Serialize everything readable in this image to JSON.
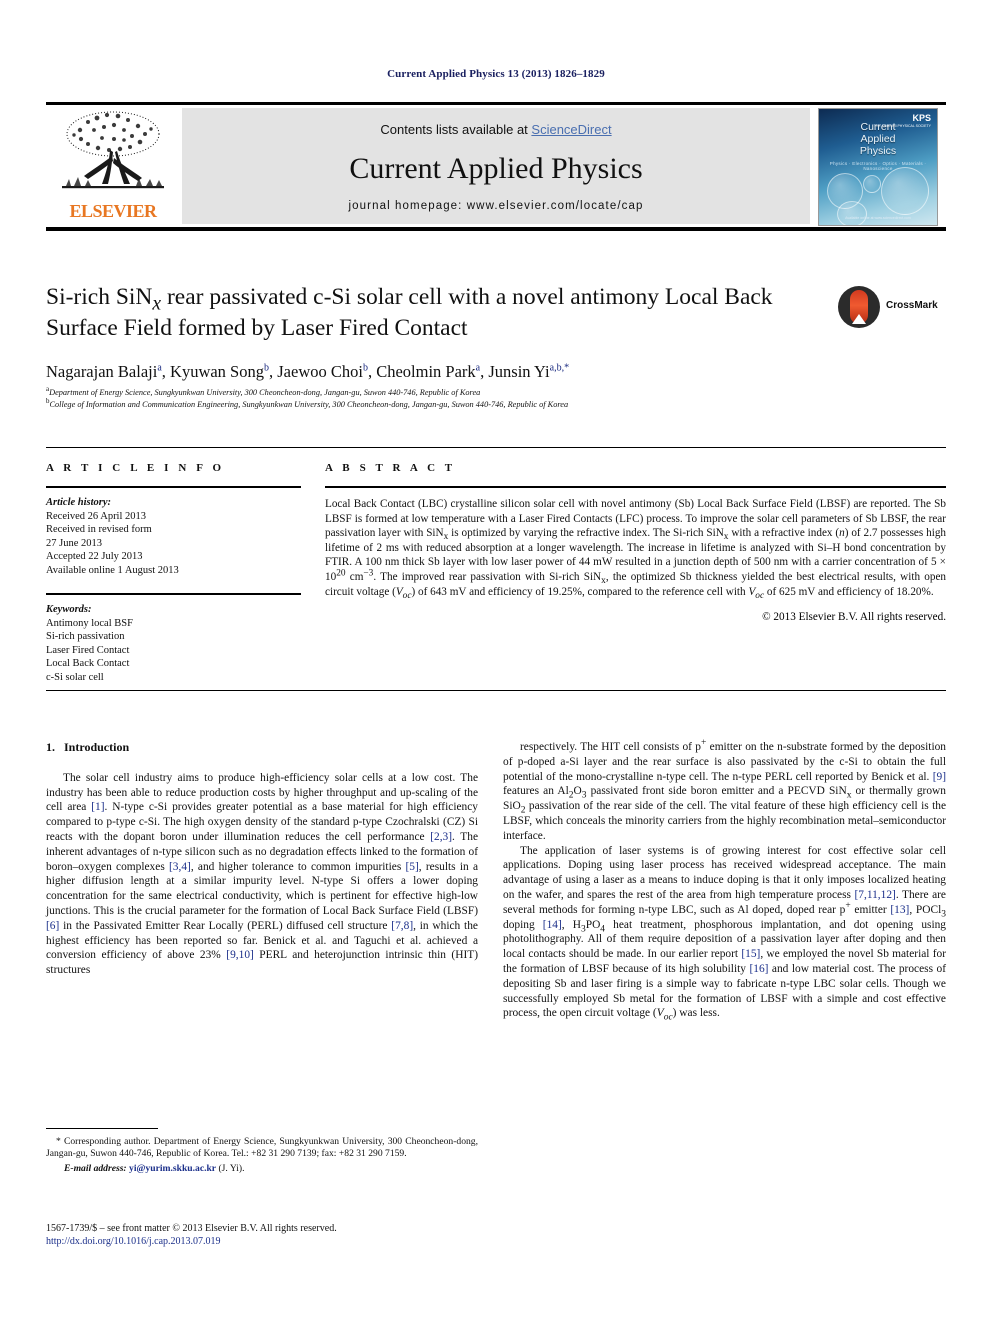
{
  "running_head": "Current Applied Physics 13 (2013) 1826–1829",
  "masthead": {
    "contents_prefix": "Contents lists available at ",
    "sciencedirect": "ScienceDirect",
    "journal_name": "Current Applied Physics",
    "homepage": "journal homepage: www.elsevier.com/locate/cap",
    "publisher_wordmark": "ELSEVIER",
    "cover": {
      "line1": "Current",
      "line2": "Applied",
      "line3": "Physics",
      "subtitle": "Physics · Electronics · Optics · Materials · Nanoscience",
      "society": "KPS",
      "society_sub": "THE KOREAN PHYSICAL SOCIETY",
      "footer": "Available online at www.sciencedirect.com"
    }
  },
  "article": {
    "title_line1_a": "Si-rich SiN",
    "title_line1_sub": "x",
    "title_line1_b": " rear passivated c-Si solar cell with a novel antimony",
    "title_line2": "Local Back Surface Field formed by Laser Fired Contact",
    "authors": [
      {
        "name": "Nagarajan Balaji",
        "marks": "a"
      },
      {
        "name": "Kyuwan Song",
        "marks": "b"
      },
      {
        "name": "Jaewoo Choi",
        "marks": "b"
      },
      {
        "name": "Cheolmin Park",
        "marks": "a"
      },
      {
        "name": "Junsin Yi",
        "marks": "a,b,*"
      }
    ],
    "affiliations": [
      {
        "mark": "a",
        "text": "Department of Energy Science, Sungkyunkwan University, 300 Cheoncheon-dong, Jangan-gu, Suwon 440-746, Republic of Korea"
      },
      {
        "mark": "b",
        "text": "College of Information and Communication Engineering, Sungkyunkwan University, 300 Cheoncheon-dong, Jangan-gu, Suwon 440-746, Republic of Korea"
      }
    ],
    "crossmark_label": "CrossMark"
  },
  "article_info": {
    "heading": "A R T I C L E   I N F O",
    "history_label": "Article history:",
    "history": [
      "Received 26 April 2013",
      "Received in revised form",
      "27 June 2013",
      "Accepted 22 July 2013",
      "Available online 1 August 2013"
    ],
    "keywords_label": "Keywords:",
    "keywords": [
      "Antimony local BSF",
      "Si-rich passivation",
      "Laser Fired Contact",
      "Local Back Contact",
      "c-Si solar cell"
    ]
  },
  "abstract": {
    "heading": "A B S T R A C T",
    "copyright": "© 2013 Elsevier B.V. All rights reserved.",
    "parts": [
      {
        "t": "text",
        "v": "Local Back Contact (LBC) crystalline silicon solar cell with novel antimony (Sb) Local Back Surface Field (LBSF) are reported. The Sb LBSF is formed at low temperature with a Laser Fired Contacts (LFC) process. To improve the solar cell parameters of Sb LBSF, the rear passivation layer with SiN"
      },
      {
        "t": "sub",
        "v": "x"
      },
      {
        "t": "text",
        "v": " is optimized by varying the refractive index. The Si-rich SiN"
      },
      {
        "t": "sub",
        "v": "x"
      },
      {
        "t": "text",
        "v": " with a refractive index ("
      },
      {
        "t": "ital",
        "v": "n"
      },
      {
        "t": "text",
        "v": ") of 2.7 possesses high lifetime of 2 ms with reduced absorption at a longer wavelength. The increase in lifetime is analyzed with Si–H bond concentration by FTIR. A 100 nm thick Sb layer with low laser power of 44 mW resulted in a junction depth of 500 nm with a carrier concentration of 5 × 10"
      },
      {
        "t": "sup",
        "v": "20"
      },
      {
        "t": "text",
        "v": " cm"
      },
      {
        "t": "sup",
        "v": "−3"
      },
      {
        "t": "text",
        "v": ". The improved rear passivation with Si-rich SiN"
      },
      {
        "t": "sub",
        "v": "x"
      },
      {
        "t": "text",
        "v": ", the optimized Sb thickness yielded the best electrical results, with open circuit voltage ("
      },
      {
        "t": "ital",
        "v": "V"
      },
      {
        "t": "italsub",
        "v": "oc"
      },
      {
        "t": "text",
        "v": ") of 643 mV and efficiency of 19.25%, compared to the reference cell with "
      },
      {
        "t": "ital",
        "v": "V"
      },
      {
        "t": "italsub",
        "v": "oc"
      },
      {
        "t": "text",
        "v": " of 625 mV and efficiency of 18.20%."
      }
    ]
  },
  "body": {
    "section_number": "1.",
    "section_title": "Introduction",
    "left_paragraphs": [
      [
        {
          "t": "text",
          "v": "The solar cell industry aims to produce high-efficiency solar cells at a low cost. The industry has been able to reduce production costs by higher throughput and up-scaling of the cell area "
        },
        {
          "t": "ref",
          "v": "[1]"
        },
        {
          "t": "text",
          "v": ". N-type c-Si provides greater potential as a base material for high efficiency compared to p-type c-Si. The high oxygen density of the standard p-type Czochralski (CZ) Si reacts with the dopant boron under illumination reduces the cell performance "
        },
        {
          "t": "ref",
          "v": "[2,3]"
        },
        {
          "t": "text",
          "v": ". The inherent advantages of n-type silicon such as no degradation effects linked to the formation of boron–oxygen complexes "
        },
        {
          "t": "ref",
          "v": "[3,4]"
        },
        {
          "t": "text",
          "v": ", and higher tolerance to common impurities "
        },
        {
          "t": "ref",
          "v": "[5]"
        },
        {
          "t": "text",
          "v": ", results in a higher diffusion length at a similar impurity level. N-type Si offers a lower doping concentration for the same electrical conductivity, which is pertinent for effective high-low junctions. This is the crucial parameter for the formation of Local Back Surface Field (LBSF) "
        },
        {
          "t": "ref",
          "v": "[6]"
        },
        {
          "t": "text",
          "v": " in the Passivated Emitter Rear Locally (PERL) diffused cell structure "
        },
        {
          "t": "ref",
          "v": "[7,8]"
        },
        {
          "t": "text",
          "v": ", in which the highest efficiency has been reported so far. Benick et al. and Taguchi et al. achieved a conversion efficiency of above 23% "
        },
        {
          "t": "ref",
          "v": "[9,10]"
        },
        {
          "t": "text",
          "v": " PERL and heterojunction intrinsic thin (HIT) structures"
        }
      ]
    ],
    "right_paragraphs": [
      [
        {
          "t": "text",
          "v": "respectively. The HIT cell consists of p"
        },
        {
          "t": "sup",
          "v": "+"
        },
        {
          "t": "text",
          "v": " emitter on the n-substrate formed by the deposition of p-doped a-Si layer and the rear surface is also passivated by the c-Si to obtain the full potential of the mono-crystalline n-type cell. The n-type PERL cell reported by Benick et al. "
        },
        {
          "t": "ref",
          "v": "[9]"
        },
        {
          "t": "text",
          "v": " features an Al"
        },
        {
          "t": "sub",
          "v": "2"
        },
        {
          "t": "text",
          "v": "O"
        },
        {
          "t": "sub",
          "v": "3"
        },
        {
          "t": "text",
          "v": " passivated front side boron emitter and a PECVD SiN"
        },
        {
          "t": "sub",
          "v": "x"
        },
        {
          "t": "text",
          "v": " or thermally grown SiO"
        },
        {
          "t": "sub",
          "v": "2"
        },
        {
          "t": "text",
          "v": " passivation of the rear side of the cell. The vital feature of these high efficiency cell is the LBSF, which conceals the minority carriers from the highly recombination metal–semiconductor interface."
        }
      ],
      [
        {
          "t": "text",
          "v": "The application of laser systems is of growing interest for cost effective solar cell applications. Doping using laser process has received widespread acceptance. The main advantage of using a laser as a means to induce doping is that it only imposes localized heating on the wafer, and spares the rest of the area from high temperature process "
        },
        {
          "t": "ref",
          "v": "[7,11,12]"
        },
        {
          "t": "text",
          "v": ". There are several methods for forming n-type LBC, such as Al doped, doped rear p"
        },
        {
          "t": "sup",
          "v": "+"
        },
        {
          "t": "text",
          "v": " emitter "
        },
        {
          "t": "ref",
          "v": "[13]"
        },
        {
          "t": "text",
          "v": ", POCl"
        },
        {
          "t": "sub",
          "v": "3"
        },
        {
          "t": "text",
          "v": " doping "
        },
        {
          "t": "ref",
          "v": "[14]"
        },
        {
          "t": "text",
          "v": ", H"
        },
        {
          "t": "sub",
          "v": "3"
        },
        {
          "t": "text",
          "v": "PO"
        },
        {
          "t": "sub",
          "v": "4"
        },
        {
          "t": "text",
          "v": " heat treatment, phosphorous implantation, and dot opening using photolithography. All of them require deposition of a passivation layer after doping and then local contacts should be made. In our earlier report "
        },
        {
          "t": "ref",
          "v": "[15]"
        },
        {
          "t": "text",
          "v": ", we employed the novel Sb material for the formation of LBSF because of its high solubility "
        },
        {
          "t": "ref",
          "v": "[16]"
        },
        {
          "t": "text",
          "v": " and low material cost. The process of depositing Sb and laser firing is a simple way to fabricate n-type LBC solar cells. Though we successfully employed Sb metal for the formation of LBSF with a simple and cost effective process, the open circuit voltage ("
        },
        {
          "t": "ital",
          "v": "V"
        },
        {
          "t": "italsub",
          "v": "oc"
        },
        {
          "t": "text",
          "v": ") was less."
        }
      ]
    ]
  },
  "footnote": {
    "corresponding": "* Corresponding author. Department of Energy Science, Sungkyunkwan University, 300 Cheoncheon-dong, Jangan-gu, Suwon 440-746, Republic of Korea. Tel.: +82 31 290 7139; fax: +82 31 290 7159.",
    "email_label": "E-mail address:",
    "email": "yi@yurim.skku.ac.kr",
    "email_suffix": " (J. Yi)."
  },
  "issn_line": {
    "text": "1567-1739/$ – see front matter © 2013 Elsevier B.V. All rights reserved.",
    "doi": "http://dx.doi.org/10.1016/j.cap.2013.07.019"
  },
  "colors": {
    "running_head": "#1a2060",
    "link": "#1b2f8a",
    "sciencedirect": "#4a6fb0",
    "elsevier_orange": "#E87722",
    "banner_bg": "#e3e3e3"
  }
}
